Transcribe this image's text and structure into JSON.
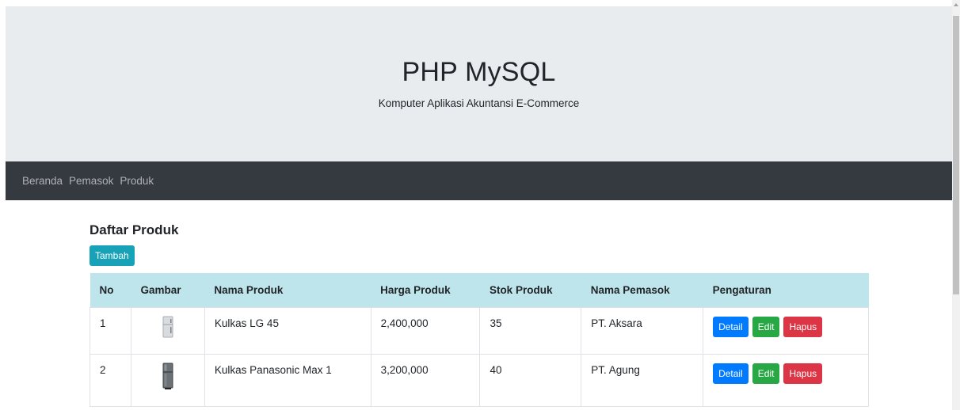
{
  "header": {
    "title": "PHP MySQL",
    "subtitle": "Komputer Aplikasi Akuntansi E-Commerce"
  },
  "nav": {
    "items": [
      "Beranda",
      "Pemasok",
      "Produk"
    ]
  },
  "main": {
    "page_title": "Daftar Produk",
    "add_label": "Tambah",
    "columns": [
      "No",
      "Gambar",
      "Nama Produk",
      "Harga Produk",
      "Stok Produk",
      "Nama Pemasok",
      "Pengaturan"
    ],
    "rows": [
      {
        "no": "1",
        "image_icon": "fridge-silver-icon",
        "name": "Kulkas LG 45",
        "price": "2,400,000",
        "stock": "35",
        "supplier": "PT. Aksara"
      },
      {
        "no": "2",
        "image_icon": "fridge-dark-icon",
        "name": "Kulkas Panasonic Max 1",
        "price": "3,200,000",
        "stock": "40",
        "supplier": "PT. Agung"
      }
    ],
    "actions": {
      "detail": "Detail",
      "edit": "Edit",
      "delete": "Hapus"
    }
  },
  "colors": {
    "jumbotron_bg": "#e9ecef",
    "navbar_bg": "#343a40",
    "table_header_bg": "#bee5eb",
    "btn_info": "#17a2b8",
    "btn_primary": "#007bff",
    "btn_success": "#28a745",
    "btn_danger": "#dc3545"
  }
}
